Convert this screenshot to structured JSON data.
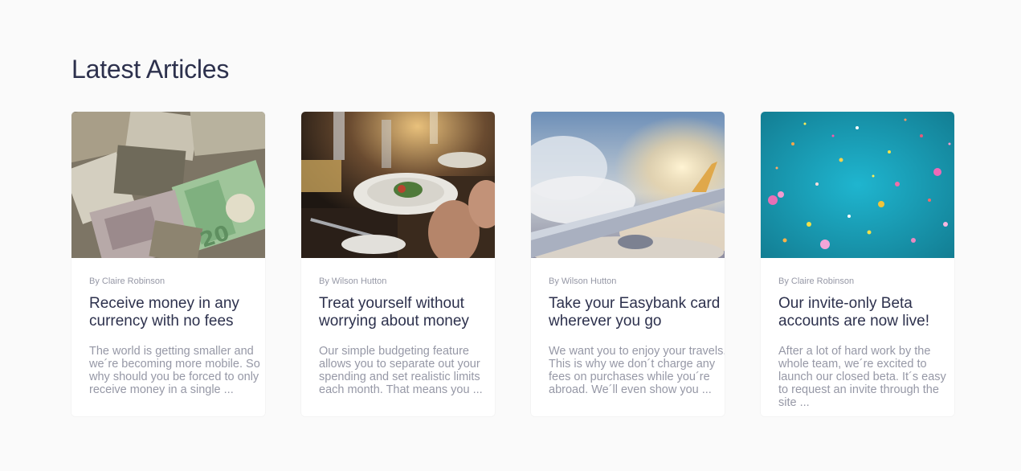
{
  "section": {
    "title": "Latest Articles"
  },
  "articles": [
    {
      "image": "money-photo",
      "author": "By Claire Robinson",
      "title": "Receive money in any currency with no fees",
      "excerpt": "The world is getting smaller and we´re becoming more mobile. So why should you be forced to only receive money in a single ..."
    },
    {
      "image": "restaurant-photo",
      "author": "By Wilson Hutton",
      "title": "Treat yourself without worrying about money",
      "excerpt": "Our simple budgeting feature allows you to separate out your spending and set realistic limits each month. That means you ..."
    },
    {
      "image": "plane-photo",
      "author": "By Wilson Hutton",
      "title": "Take your Easybank card wherever you go",
      "excerpt": "We want you to enjoy your travels. This is why we don´t charge any fees on purchases while you´re abroad. We´ll even show you ..."
    },
    {
      "image": "confetti-photo",
      "author": "By Claire Robinson",
      "title": "Our invite-only Beta accounts are now live!",
      "excerpt": "After a lot of hard work by the whole team, we´re excited to launch our closed beta. It´s easy to request an invite through the site ..."
    }
  ]
}
